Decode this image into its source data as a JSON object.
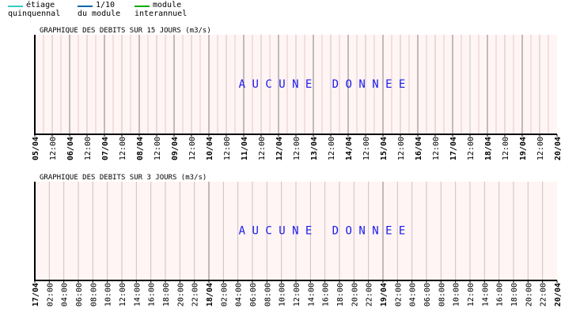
{
  "legend": {
    "items": [
      {
        "line1": "étiage",
        "line2": "quinquennal",
        "color": "#33cccc"
      },
      {
        "line1": "1/10",
        "line2": "du module",
        "color": "#0066aa"
      },
      {
        "line1": "module",
        "line2": "interannuel",
        "color": "#00aa00"
      }
    ]
  },
  "chart_data": [
    {
      "type": "line",
      "title": "GRAPHIQUE DES DEBITS SUR 15 JOURS (m3/s)",
      "no_data_text": "A U C U N E   D O N N E E",
      "tick_labels": [
        "05/04",
        "12:00",
        "06/04",
        "12:00",
        "07/04",
        "12:00",
        "08/04",
        "12:00",
        "09/04",
        "12:00",
        "10/04",
        "12:00",
        "11/04",
        "12:00",
        "12/04",
        "12:00",
        "13/04",
        "12:00",
        "14/04",
        "12:00",
        "15/04",
        "12:00",
        "16/04",
        "12:00",
        "17/04",
        "12:00",
        "18/04",
        "12:00",
        "19/04",
        "12:00",
        "20/04"
      ],
      "major_every": 2,
      "minor_per_tick": 2,
      "grid": true,
      "background": "#fff5f5",
      "series": []
    },
    {
      "type": "line",
      "title": "GRAPHIQUE DES DEBITS SUR 3 JOURS (m3/s)",
      "no_data_text": "A U C U N E   D O N N E E",
      "tick_labels": [
        "17/04",
        "02:00",
        "04:00",
        "06:00",
        "08:00",
        "10:00",
        "12:00",
        "14:00",
        "16:00",
        "18:00",
        "20:00",
        "22:00",
        "18/04",
        "02:00",
        "04:00",
        "06:00",
        "08:00",
        "10:00",
        "12:00",
        "14:00",
        "16:00",
        "18:00",
        "20:00",
        "22:00",
        "19/04",
        "02:00",
        "04:00",
        "06:00",
        "08:00",
        "10:00",
        "12:00",
        "14:00",
        "16:00",
        "18:00",
        "20:00",
        "22:00",
        "20/04"
      ],
      "major_every": 12,
      "minor_per_tick": 1,
      "grid": true,
      "background": "#fff5f5",
      "series": []
    }
  ]
}
